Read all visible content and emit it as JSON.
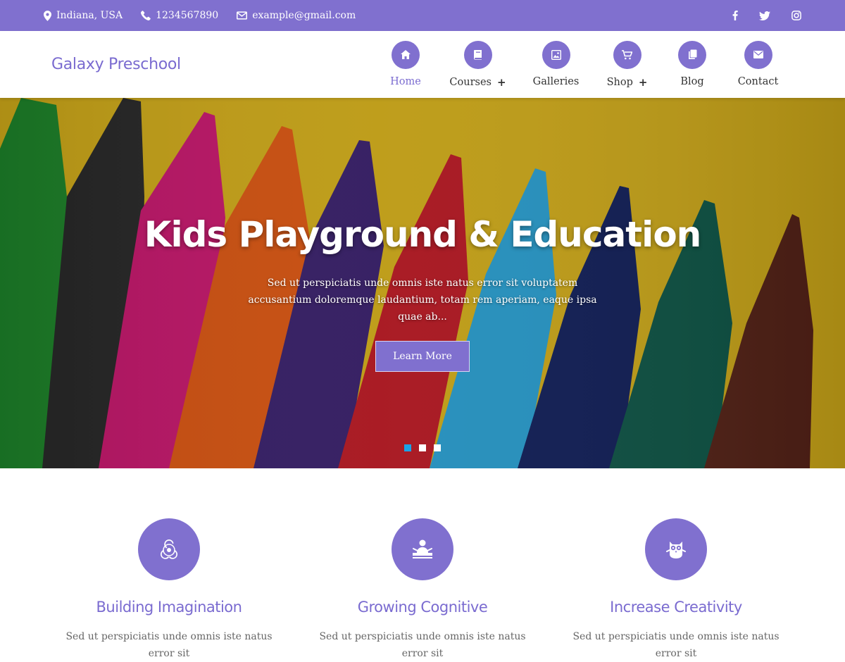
{
  "topbar": {
    "location": "Indiana, USA",
    "phone": "1234567890",
    "email": "example@gmail.com",
    "social": [
      "facebook-icon",
      "twitter-icon",
      "instagram-icon"
    ]
  },
  "header": {
    "logo": "Galaxy Preschool",
    "nav": [
      {
        "label": "Home",
        "icon": "home-icon",
        "active": true,
        "plus": ""
      },
      {
        "label": "Courses",
        "icon": "book-icon",
        "active": false,
        "plus": "+"
      },
      {
        "label": "Galleries",
        "icon": "gallery-icon",
        "active": false,
        "plus": ""
      },
      {
        "label": "Shop",
        "icon": "cart-icon",
        "active": false,
        "plus": "+"
      },
      {
        "label": "Blog",
        "icon": "copy-icon",
        "active": false,
        "plus": ""
      },
      {
        "label": "Contact",
        "icon": "envelope-icon",
        "active": false,
        "plus": ""
      }
    ]
  },
  "hero": {
    "title": "Kids Playground & Education",
    "text": "Sed ut perspiciatis unde omnis iste natus error sit voluptatem accusantium doloremque laudantium, totam rem aperiam, eaque ipsa quae ab...",
    "button": "Learn More",
    "slides": 3,
    "active_slide": 1
  },
  "features": [
    {
      "icon": "biohazard-icon",
      "title": "Building Imagination",
      "text": "Sed ut perspiciatis unde omnis iste natus error sit"
    },
    {
      "icon": "teacher-icon",
      "title": "Growing Cognitive",
      "text": "Sed ut perspiciatis unde omnis iste natus error sit"
    },
    {
      "icon": "owl-icon",
      "title": "Increase Creativity",
      "text": "Sed ut perspiciatis unde omnis iste natus error sit"
    }
  ],
  "colors": {
    "accent": "#8070cf",
    "accent_text": "#7a6bd0",
    "hero_background": "#d9b21a",
    "active_dot": "#1aa3e8"
  }
}
